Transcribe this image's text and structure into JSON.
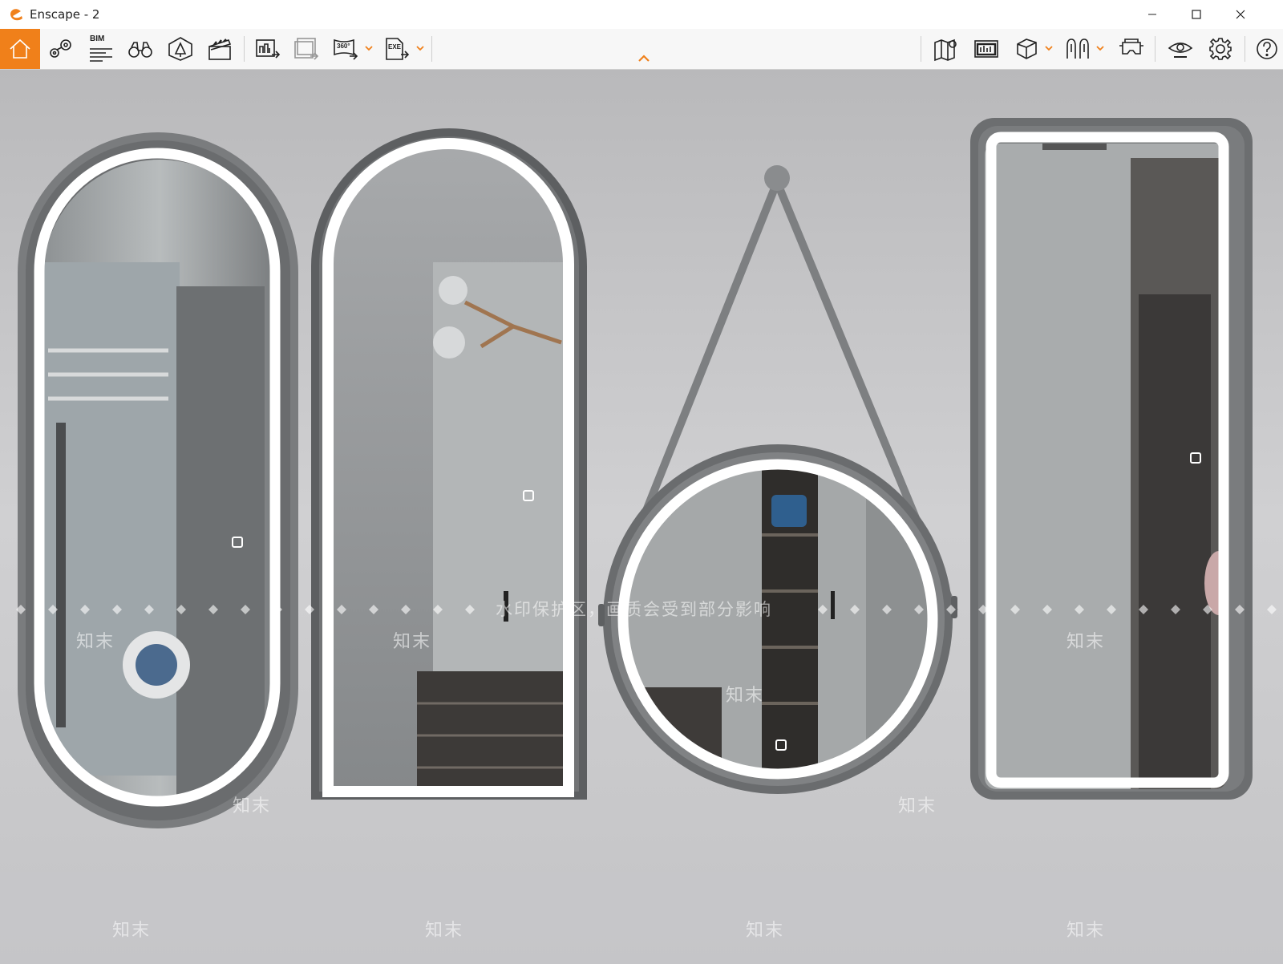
{
  "window": {
    "title": "Enscape - 2",
    "controls": [
      "minimize",
      "maximize",
      "close"
    ]
  },
  "toolbar": {
    "accent_color": "#f0801a",
    "left_tools": [
      {
        "icon": "home-icon",
        "active": true
      },
      {
        "icon": "map-pin-icon"
      },
      {
        "icon": "bim-icon",
        "label": "BIM"
      },
      {
        "icon": "binoculars-icon"
      },
      {
        "icon": "asset-library-icon"
      },
      {
        "icon": "clapperboard-icon"
      },
      {
        "icon": "render-export-icon"
      },
      {
        "icon": "batch-render-icon"
      },
      {
        "icon": "panorama-360-icon",
        "label": "360°"
      },
      {
        "icon": "exe-export-icon",
        "label": "EXE"
      }
    ],
    "right_tools": [
      {
        "icon": "map-view-icon"
      },
      {
        "icon": "screen-capture-icon"
      },
      {
        "icon": "cube-icon"
      },
      {
        "icon": "people-icon"
      },
      {
        "icon": "vr-headset-icon"
      },
      {
        "icon": "eye-icon"
      },
      {
        "icon": "gear-icon"
      },
      {
        "icon": "help-icon"
      }
    ]
  },
  "viewport": {
    "scene": "Four LED-lit mirrors on a grey wall: oval, arched, round hanging, rounded rectangle",
    "watermark_line": "水印保护区，画质会受到部分影响",
    "watermark_tile": "知末"
  }
}
